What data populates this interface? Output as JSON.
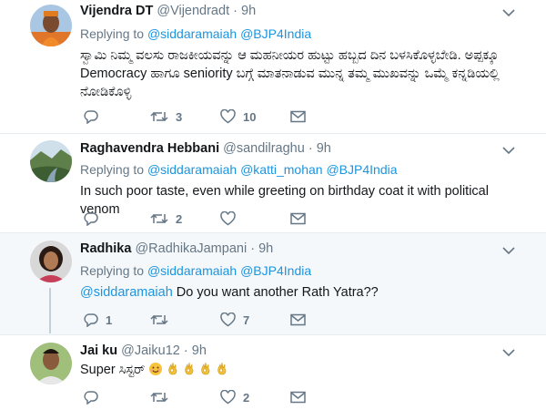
{
  "tweets": [
    {
      "name": "Vijendra DT",
      "handle": "@Vijendradt",
      "dot": "·",
      "time": "9h",
      "replying_prefix": "Replying to ",
      "mentions": [
        "@siddaramaiah",
        "@BJP4India"
      ],
      "text_line1": "ಸ್ವಾಮಿ ನಿಮ್ಮ ವಲಸು ರಾಜಕೀಯವನ್ನು ಆ ಮಹನೀಯರ ಹುಟ್ಟು ಹಬ್ಬದ ದಿನ ಬಳಸಿಕೊಳ್ಳಬೇಡಿ. ಅಪ್ಪಕ್ಕೂ",
      "text_line2": "Democracy ಹಾಗೂ seniority ಬಗ್ಗೆ ಮಾತನಾಡುವ ಮುನ್ನ ತಮ್ಮ ಮುಖವನ್ನು ಒಮ್ಮೆ ಕನ್ನಡಿಯಲ್ಲಿ",
      "text_line3": "ನೋಡಿಕೊಳ್ಳಿ",
      "replies": "",
      "retweets": "3",
      "likes": "10"
    },
    {
      "name": "Raghavendra Hebbani",
      "handle": "@sandilraghu",
      "dot": "·",
      "time": "9h",
      "replying_prefix": "Replying to ",
      "mentions": [
        "@siddaramaiah",
        "@katti_mohan",
        "@BJP4India"
      ],
      "text": "In such poor taste, even while greeting on birthday coat it with political venom",
      "replies": "",
      "retweets": "2",
      "likes": ""
    },
    {
      "name": "Radhika",
      "handle": "@RadhikaJampani",
      "dot": "·",
      "time": "9h",
      "replying_prefix": "Replying to ",
      "mentions": [
        "@siddaramaiah",
        "@BJP4India"
      ],
      "text_mention": "@siddaramaiah",
      "text": " Do you want another Rath Yatra??",
      "replies": "1",
      "retweets": "",
      "likes": "7"
    },
    {
      "name": "Jai ku",
      "handle": "@Jaiku12",
      "dot": "·",
      "time": "9h",
      "text": "Super ಸಿಸ್ಟರ್",
      "replies": "",
      "retweets": "",
      "likes": "2"
    }
  ],
  "icons": {
    "reply": "reply-icon",
    "retweet": "retweet-icon",
    "like": "heart-icon",
    "dm": "envelope-icon",
    "more": "chevron-down-icon"
  },
  "colors": {
    "link": "#1b95e0",
    "secondary": "#657786",
    "highlight_bg": "#f5f8fa"
  }
}
